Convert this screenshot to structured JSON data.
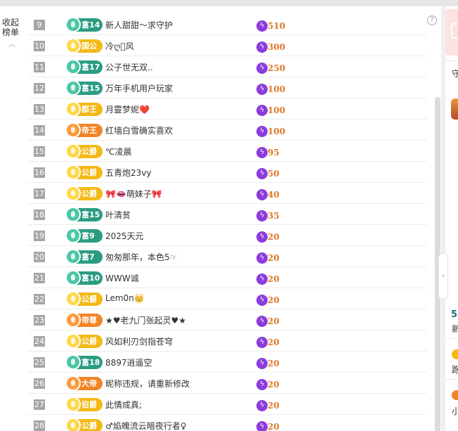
{
  "sidebar_toggle": {
    "label_line1": "收起",
    "label_line2": "榜单",
    "icon": "chevron-up-icon"
  },
  "help_icon": "?",
  "colors": {
    "rich": "#2b9c82",
    "noble": "#f3b917",
    "emperor": "#f08528",
    "score": "#e0782a",
    "bolt": "#8c3bdc"
  },
  "rows": [
    {
      "rank": "9",
      "badge": "富14",
      "style": "fu",
      "name": "新人甜甜～求守护",
      "score": "510"
    },
    {
      "rank": "10",
      "badge": "国公",
      "style": "gold",
      "name": "冷ღ⃝风",
      "score": "300"
    },
    {
      "rank": "11",
      "badge": "富17",
      "style": "fu",
      "name": "公子世无双..",
      "score": "250"
    },
    {
      "rank": "12",
      "badge": "富15",
      "style": "fu",
      "name": "万年手机用户玩家",
      "score": "100"
    },
    {
      "rank": "13",
      "badge": "郡王",
      "style": "gold",
      "name": "月靈梦妮❤️",
      "score": "100"
    },
    {
      "rank": "14",
      "badge": "帝王",
      "style": "orange",
      "name": "红墙白雪确实喜欢",
      "score": "100"
    },
    {
      "rank": "15",
      "badge": "公爵",
      "style": "gold",
      "name": "℃凌晨",
      "score": "95"
    },
    {
      "rank": "16",
      "badge": "公爵",
      "style": "gold",
      "name": "五青炮23vy",
      "score": "50"
    },
    {
      "rank": "17",
      "badge": "公爵",
      "style": "gold",
      "name": "🎀👄萌妹子🎀",
      "score": "40"
    },
    {
      "rank": "18",
      "badge": "富15",
      "style": "fu",
      "name": "叶清贫",
      "score": "35"
    },
    {
      "rank": "19",
      "badge": "富9",
      "style": "fu",
      "name": "2025天元",
      "score": "20"
    },
    {
      "rank": "20",
      "badge": "富7",
      "style": "fu",
      "name": "匆匆那年，本色5☞",
      "score": "20"
    },
    {
      "rank": "21",
      "badge": "富10",
      "style": "fu",
      "name": "WWW诚",
      "score": "20"
    },
    {
      "rank": "22",
      "badge": "公爵",
      "style": "gold",
      "name": "Lem0n👑",
      "score": "20"
    },
    {
      "rank": "23",
      "badge": "帝尊",
      "style": "orange",
      "name": "★♥老九门张起灵♥★",
      "score": "20"
    },
    {
      "rank": "24",
      "badge": "公爵",
      "style": "gold",
      "name": "风如利刃剑指苍穹",
      "score": "20"
    },
    {
      "rank": "25",
      "badge": "富18",
      "style": "fu",
      "name": "8897逍遥空",
      "score": "20"
    },
    {
      "rank": "26",
      "badge": "大帝",
      "style": "orange",
      "name": "昵称违规，请重新修改",
      "score": "20"
    },
    {
      "rank": "27",
      "badge": "伯爵",
      "style": "gold",
      "name": "此情成真;",
      "score": "20"
    },
    {
      "rank": "28",
      "badge": "公爵",
      "style": "gold",
      "name": "♂焰魄流云暗夜行者♀",
      "score": "20"
    }
  ],
  "side": {
    "t1": "守",
    "t2": "5",
    "t3": "新",
    "t4": "跑",
    "t5": "小"
  }
}
